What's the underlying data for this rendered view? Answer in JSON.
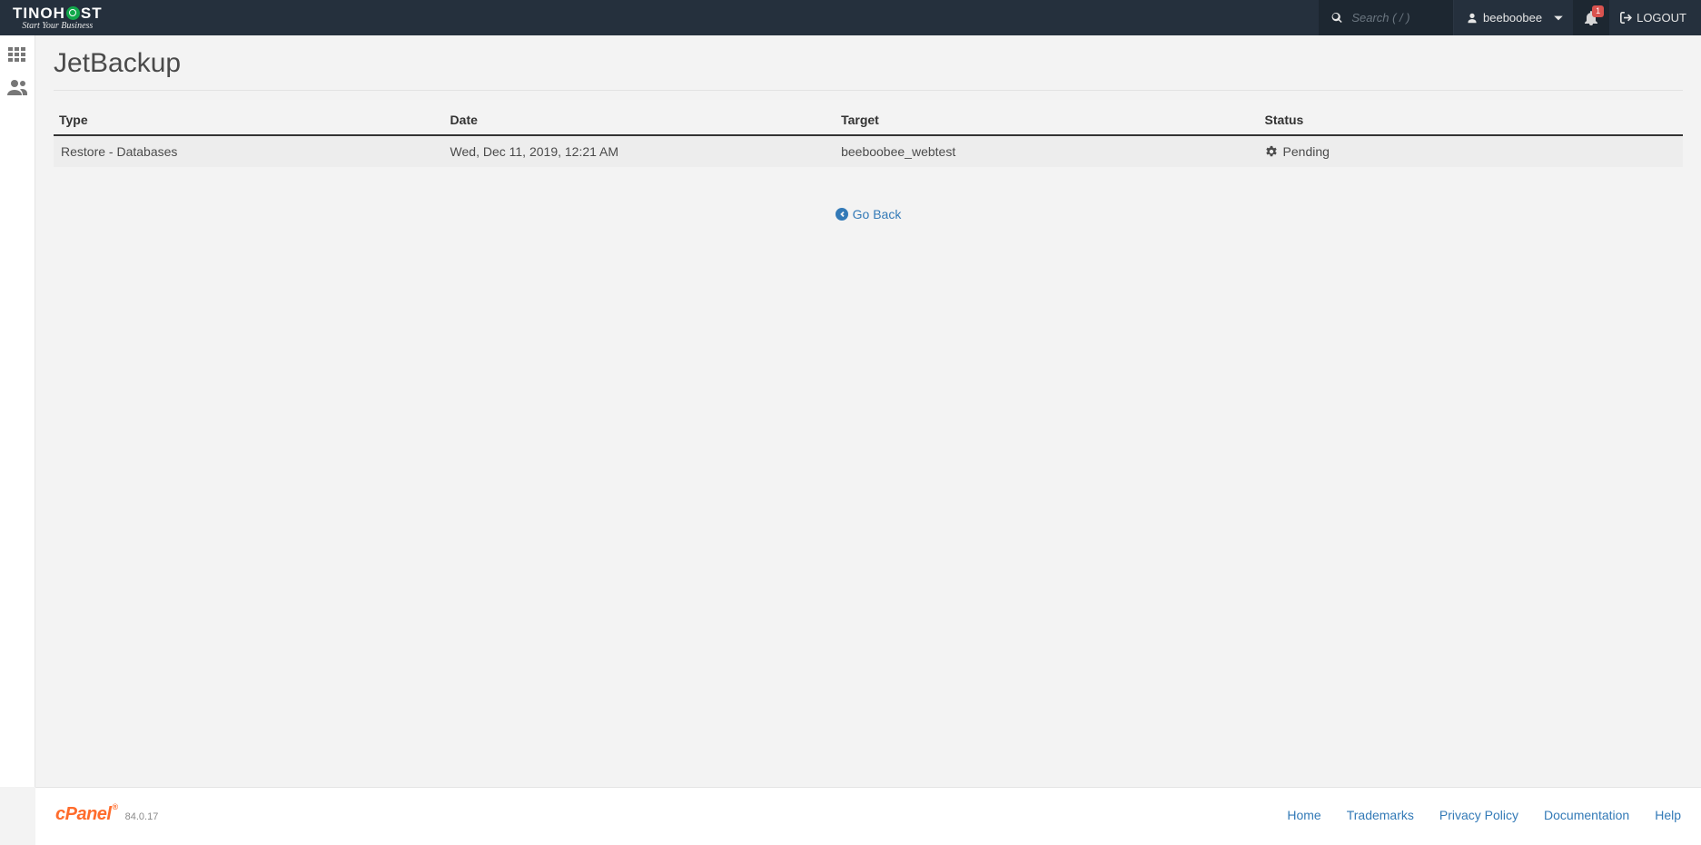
{
  "header": {
    "logo_main_pre": "TINOH",
    "logo_main_post": "ST",
    "logo_sub": "Start Your Business",
    "search_placeholder": "Search ( / )",
    "username": "beeboobee",
    "notif_count": "1",
    "logout_label": "LOGOUT"
  },
  "page": {
    "title": "JetBackup",
    "go_back_label": "Go Back"
  },
  "table": {
    "headers": {
      "type": "Type",
      "date": "Date",
      "target": "Target",
      "status": "Status"
    },
    "rows": [
      {
        "type": "Restore - Databases",
        "date": "Wed, Dec 11, 2019, 12:21 AM",
        "target": "beeboobee_webtest",
        "status": "Pending"
      }
    ]
  },
  "footer": {
    "brand": "cPanel",
    "version": "84.0.17",
    "links": {
      "home": "Home",
      "trademarks": "Trademarks",
      "privacy": "Privacy Policy",
      "documentation": "Documentation",
      "help": "Help"
    }
  }
}
